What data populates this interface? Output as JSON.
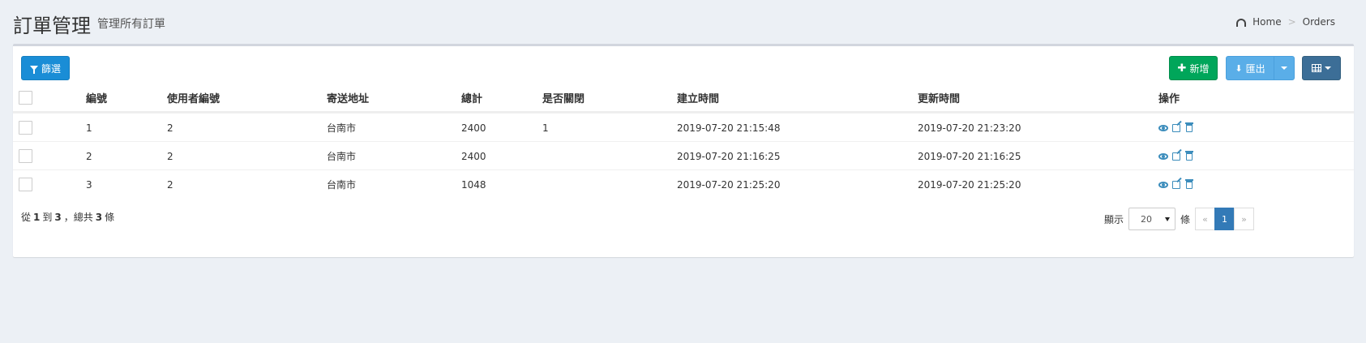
{
  "header": {
    "title": "訂單管理",
    "subtitle": "管理所有訂單",
    "breadcrumb": [
      {
        "label": "Home"
      },
      {
        "label": "Orders"
      }
    ]
  },
  "toolbar": {
    "filter_label": "篩選",
    "add_label": "新增",
    "export_label": "匯出"
  },
  "table": {
    "columns": [
      "編號",
      "使用者編號",
      "寄送地址",
      "總計",
      "是否關閉",
      "建立時間",
      "更新時間",
      "操作"
    ],
    "rows": [
      {
        "id": "1",
        "user_id": "2",
        "address": "台南市",
        "total": "2400",
        "closed": "1",
        "created_at": "2019-07-20 21:15:48",
        "updated_at": "2019-07-20 21:23:20"
      },
      {
        "id": "2",
        "user_id": "2",
        "address": "台南市",
        "total": "2400",
        "closed": "",
        "created_at": "2019-07-20 21:16:25",
        "updated_at": "2019-07-20 21:16:25"
      },
      {
        "id": "3",
        "user_id": "2",
        "address": "台南市",
        "total": "1048",
        "closed": "",
        "created_at": "2019-07-20 21:25:20",
        "updated_at": "2019-07-20 21:25:20"
      }
    ]
  },
  "footer": {
    "summary_from_label": "從",
    "summary_from": "1",
    "summary_to_label": "到",
    "summary_to": "3",
    "summary_total_label": "，總共",
    "summary_total": "3",
    "summary_unit": "條",
    "per_page_label": "顯示",
    "per_page_value": "20",
    "per_page_unit": "條",
    "pagination": {
      "prev": "«",
      "current": "1",
      "next": "»"
    }
  },
  "colors": {
    "filter": "#1a8dd6",
    "add": "#00a65a",
    "export": "#5aaee8",
    "columns": "#3c6e97",
    "action_icon": "#3c8dbc",
    "active_page": "#337ab7"
  }
}
